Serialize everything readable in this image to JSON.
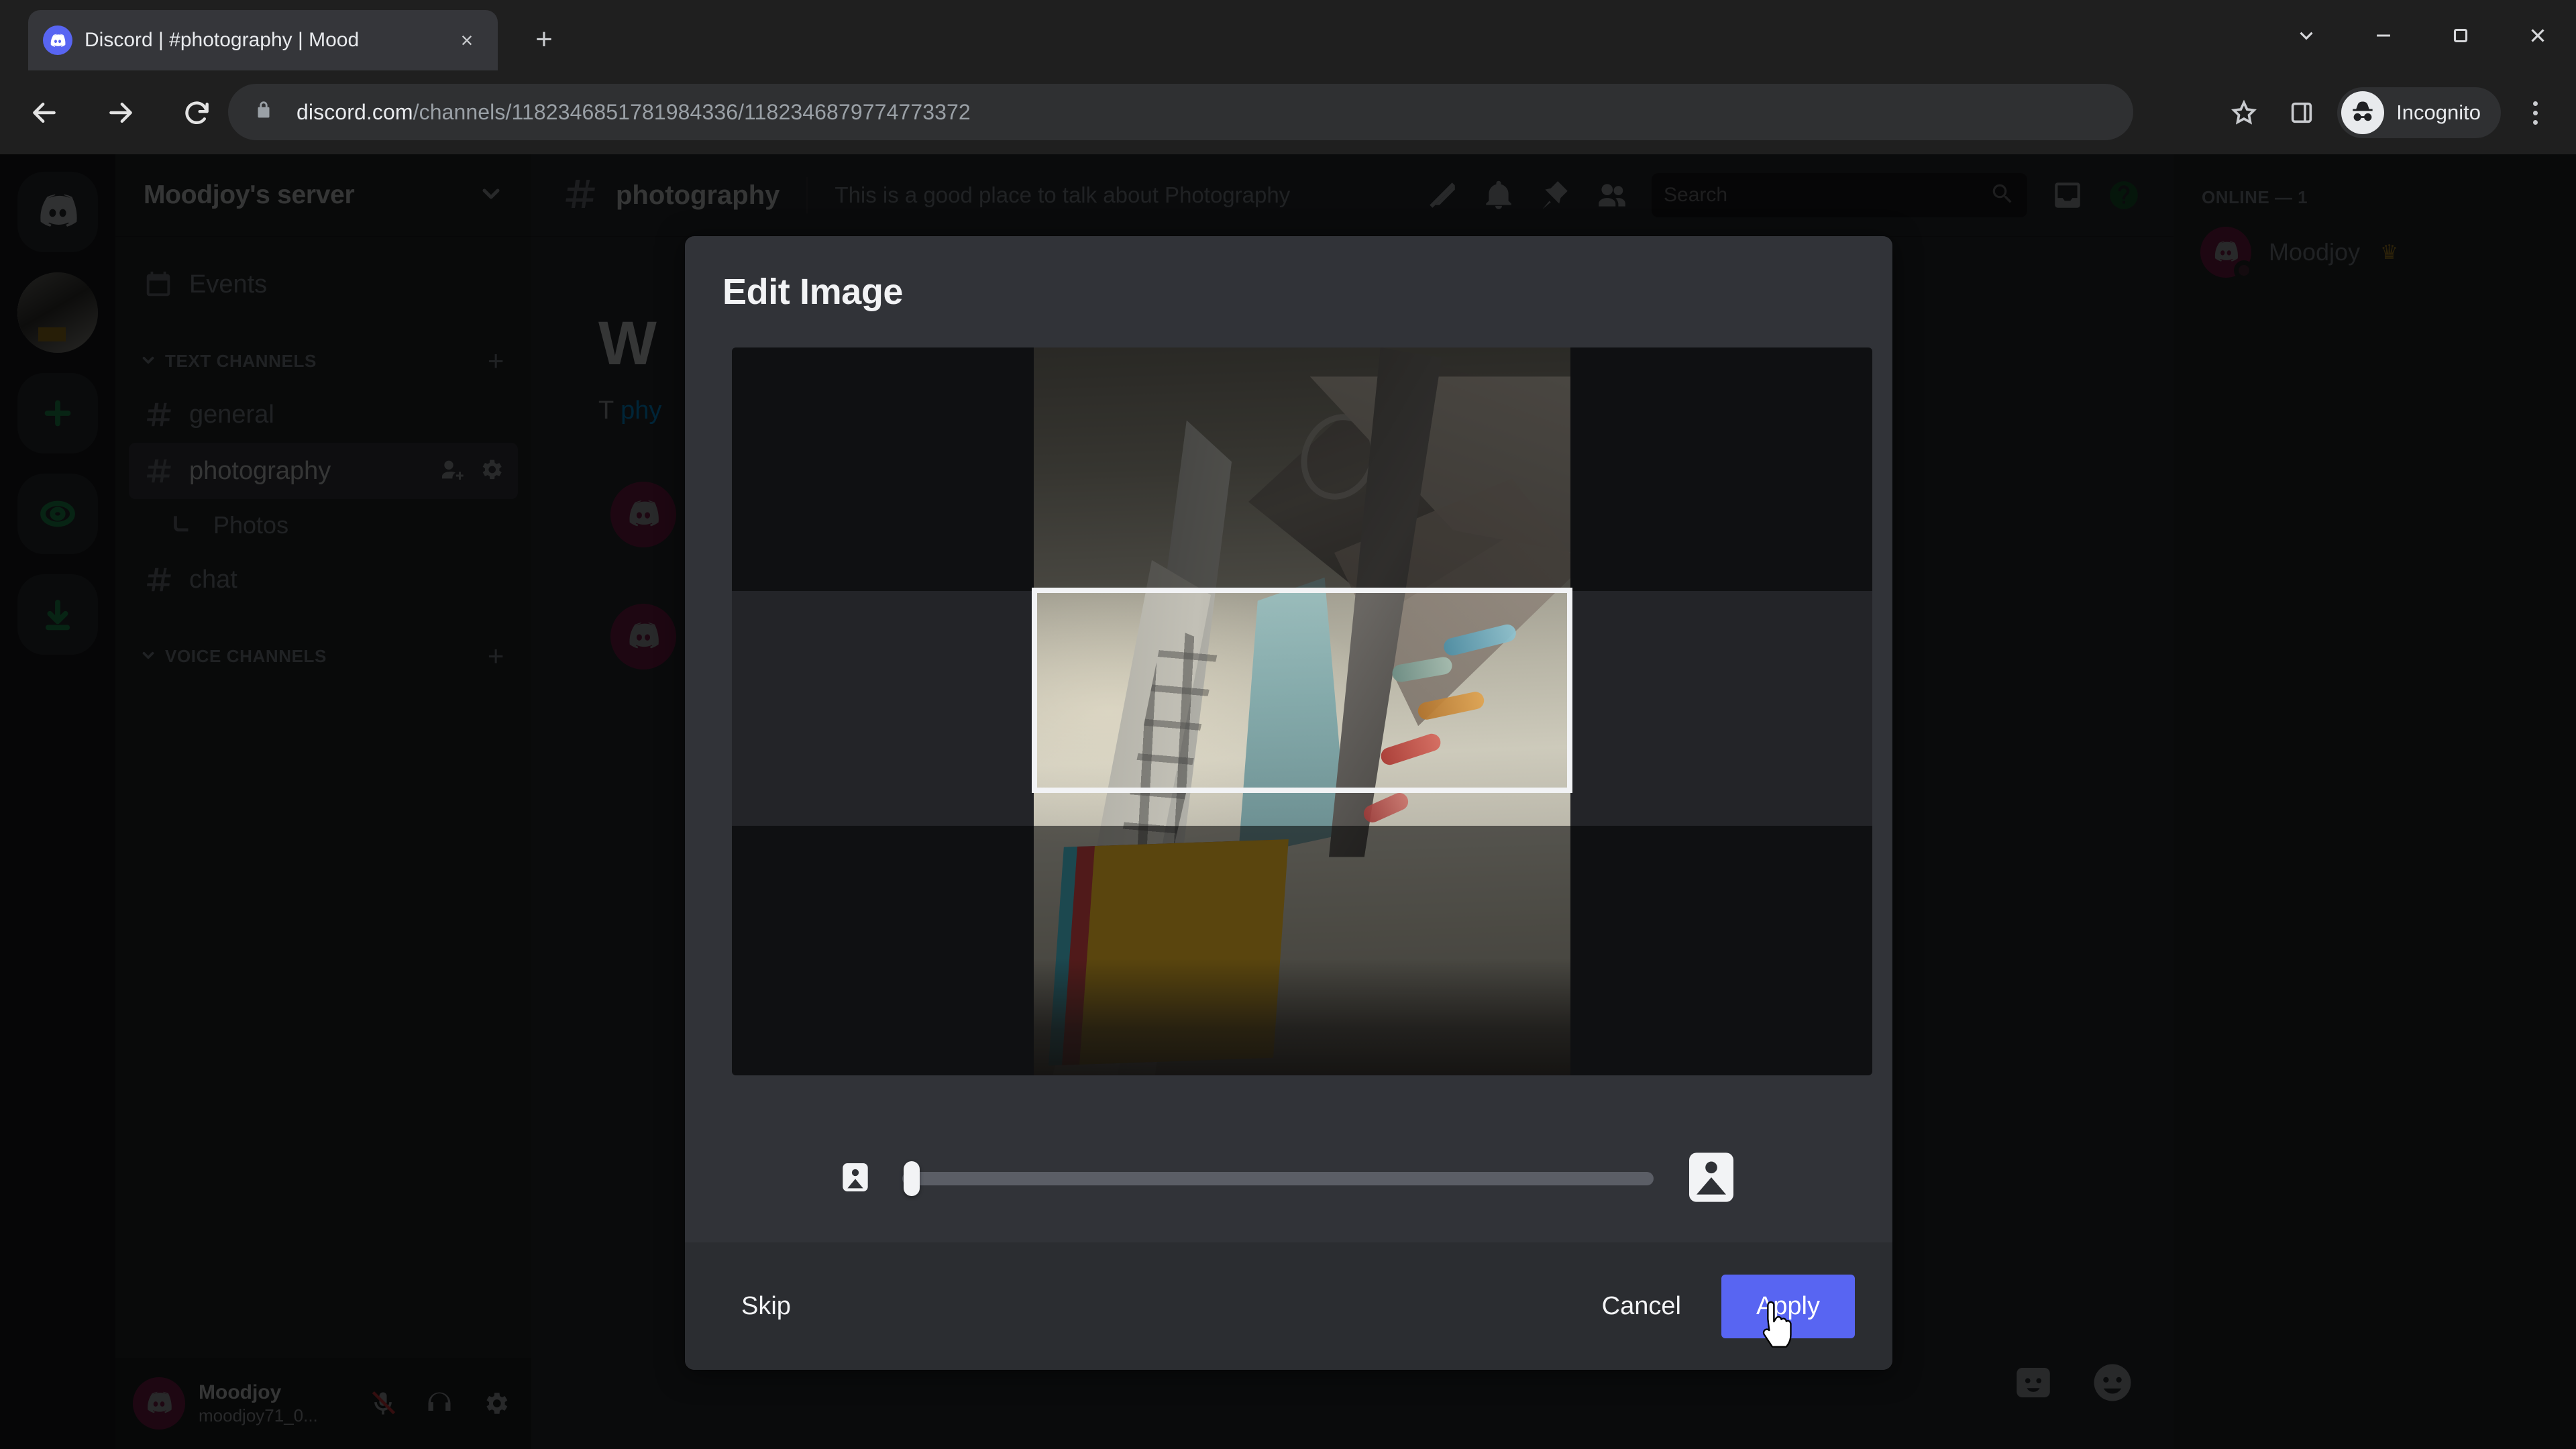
{
  "browser": {
    "tab": {
      "title": "Discord | #photography | Mood",
      "favicon": "discord-icon",
      "close": "×"
    },
    "new_tab_label": "+",
    "window_controls": [
      "chevron-down-icon",
      "minimize-icon",
      "maximize-icon",
      "close-icon"
    ],
    "nav": {
      "back": "back-arrow-icon",
      "forward": "forward-arrow-icon",
      "reload": "reload-icon"
    },
    "omnibox": {
      "lock": "lock-icon",
      "host": "discord.com",
      "path": "/channels/1182346851781984336/1182346879774773372"
    },
    "toolbar_right": {
      "bookmark": "star-icon",
      "side_panel": "side-panel-icon",
      "profile_label": "Incognito",
      "menu": "three-dot-menu-icon"
    }
  },
  "discord": {
    "server_rail": [
      {
        "name": "home",
        "icon": "discord-home-icon"
      },
      {
        "name": "moodjoy-server",
        "icon": "server-avatar"
      },
      {
        "name": "add-server",
        "icon": "plus-icon"
      },
      {
        "name": "explore-servers",
        "icon": "compass-icon"
      },
      {
        "name": "download-apps",
        "icon": "download-icon"
      }
    ],
    "server": {
      "name": "Moodjoy's server",
      "chevron": "chevron-down-icon"
    },
    "events": {
      "label": "Events",
      "icon": "calendar-icon"
    },
    "categories": [
      {
        "label": "TEXT CHANNELS",
        "add": "+",
        "channels": [
          {
            "label": "general",
            "icon": "hash-icon",
            "selected": false
          },
          {
            "label": "photography",
            "icon": "hash-icon",
            "selected": true,
            "actions": [
              "add-member-icon",
              "gear-icon"
            ]
          }
        ],
        "threads": [
          {
            "label": "Photos",
            "icon": "thread-icon"
          }
        ],
        "channels_after": [
          {
            "label": "chat",
            "icon": "hash-icon",
            "selected": false
          }
        ]
      },
      {
        "label": "VOICE CHANNELS",
        "add": "+",
        "channels": []
      }
    ],
    "user_panel": {
      "display_name": "Moodjoy",
      "username": "moodjoy71_0...",
      "actions": [
        "mic-muted-icon",
        "headphones-icon",
        "gear-icon"
      ]
    },
    "chat_header": {
      "hash": "hash-icon",
      "channel": "photography",
      "topic": "This is a good place to talk about Photography",
      "icons": [
        "threads-icon",
        "bell-icon",
        "pin-icon",
        "members-icon"
      ],
      "search_placeholder": "Search",
      "search_icon": "search-icon",
      "inbox_icon": "inbox-icon",
      "help_icon": "help-icon"
    },
    "welcome": {
      "title": "W",
      "subtitle": "T",
      "link": "phy"
    },
    "members": {
      "group_label": "ONLINE — 1",
      "list": [
        {
          "name": "Moodjoy",
          "badge": "♛"
        }
      ]
    },
    "composer_icons": [
      "gif-icon",
      "emoji-icon"
    ]
  },
  "modal": {
    "title": "Edit Image",
    "zoom": {
      "min_icon": "small-image-icon",
      "max_icon": "large-image-icon",
      "value": 0
    },
    "buttons": {
      "skip": "Skip",
      "cancel": "Cancel",
      "apply": "Apply"
    },
    "accent_color": "#5865f2"
  }
}
